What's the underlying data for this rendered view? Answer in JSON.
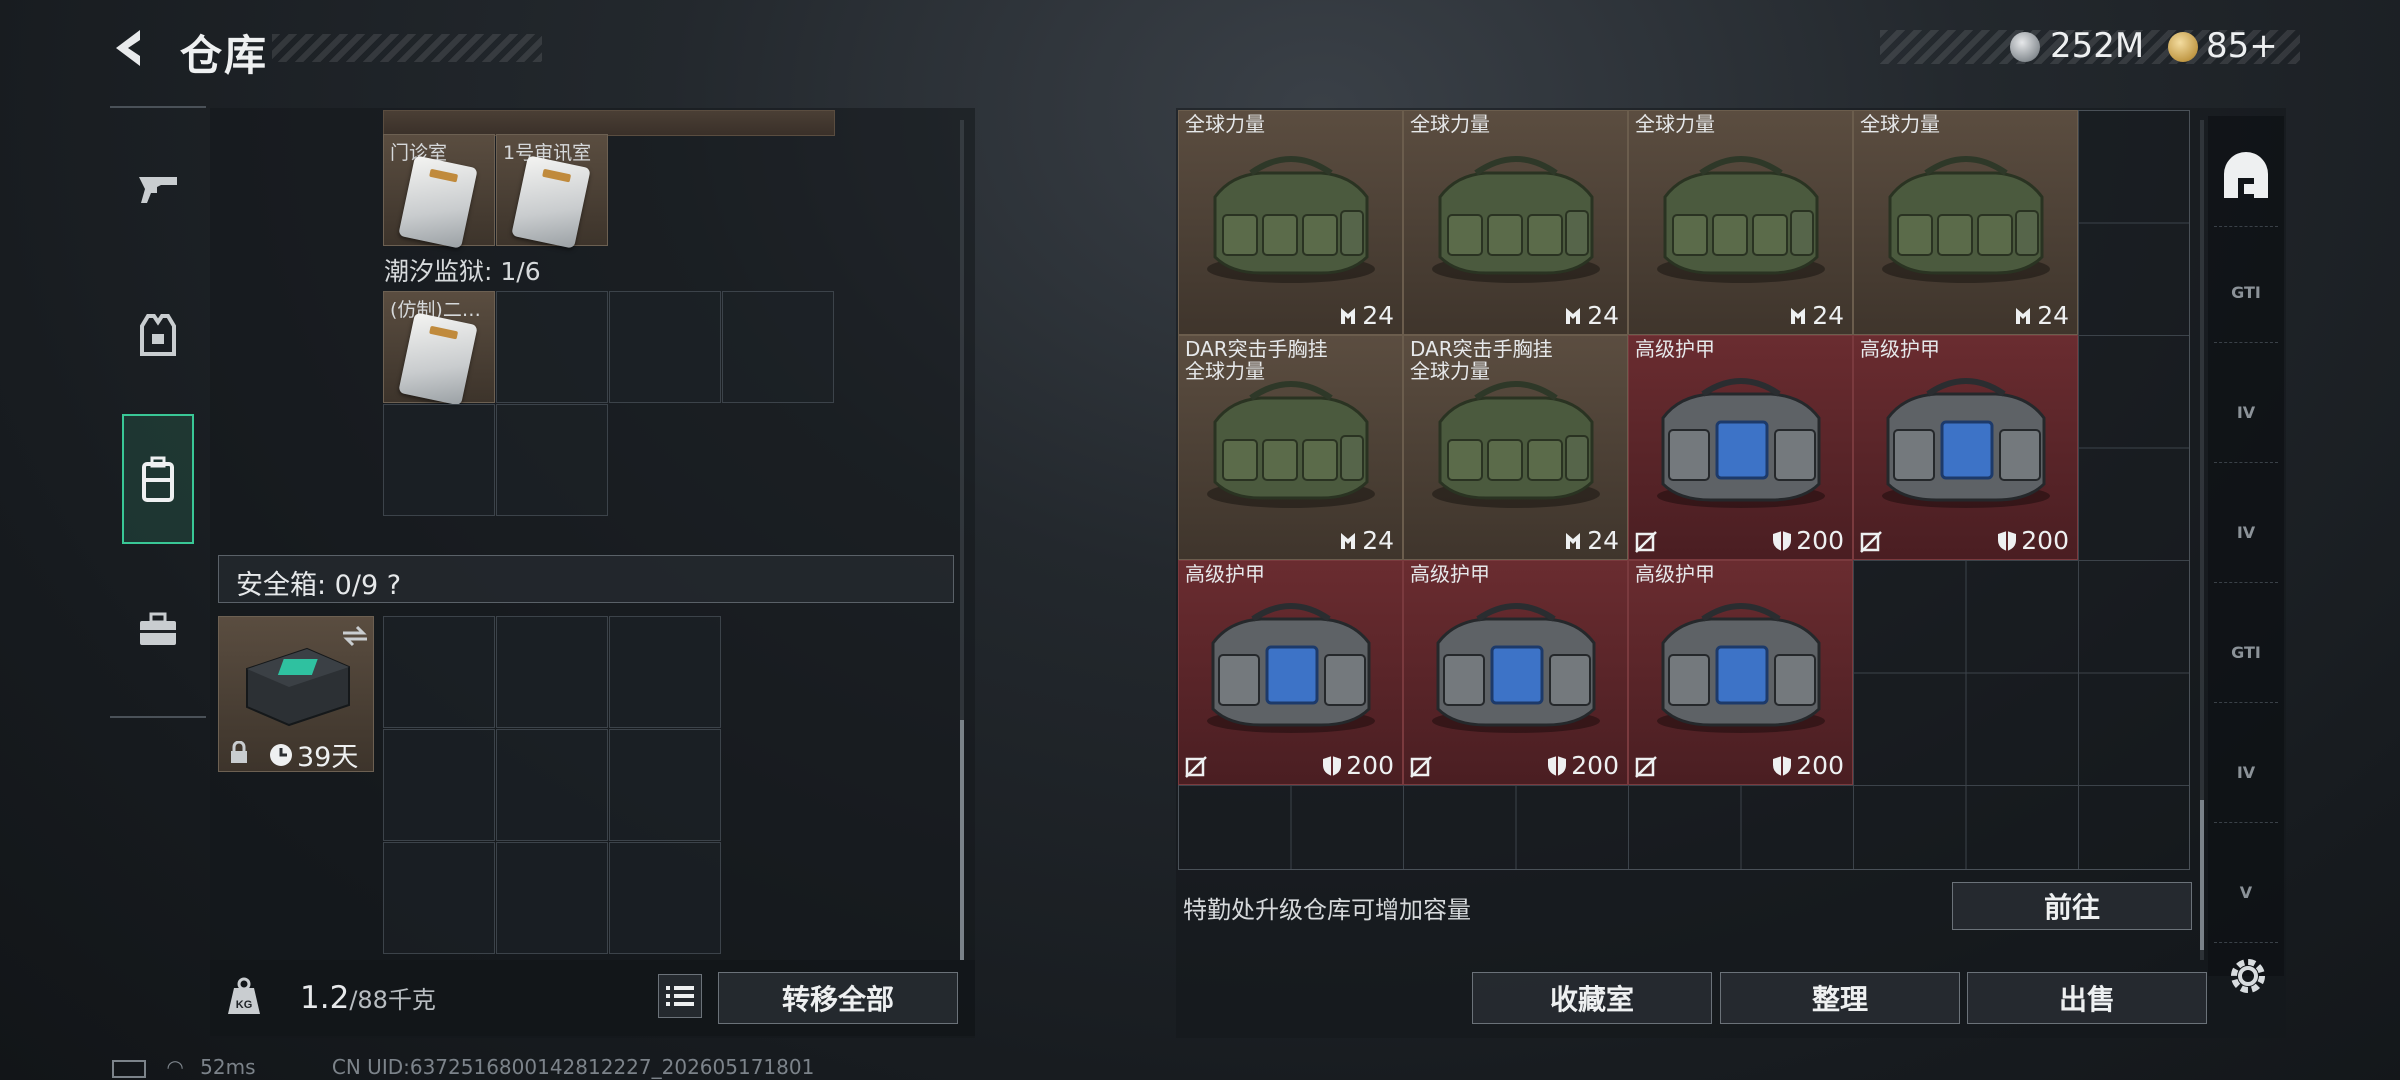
{
  "header": {
    "title": "仓库",
    "currency_1": "252M",
    "currency_2": "85+"
  },
  "left": {
    "row_top_cells": [
      {
        "label": "门诊室"
      },
      {
        "label": "1号审讯室"
      }
    ],
    "section_label": "潮汐监狱: 1/6",
    "prison_item_label": "(仿制)二…",
    "safebox_label": "安全箱: 0/9 ?",
    "safebox_time": "39天",
    "weight_value": "1.2",
    "weight_unit": "/88千克",
    "transfer_all": "转移全部"
  },
  "right": {
    "items": [
      {
        "name": "全球力量",
        "value": "24",
        "type": "green",
        "stat": "capacity"
      },
      {
        "name": "全球力量",
        "value": "24",
        "type": "green",
        "stat": "capacity"
      },
      {
        "name": "全球力量",
        "value": "24",
        "type": "green",
        "stat": "capacity"
      },
      {
        "name": "全球力量",
        "value": "24",
        "type": "green",
        "stat": "capacity"
      },
      {
        "name": "DAR突击手胸挂\n全球力量",
        "value": "24",
        "type": "green",
        "stat": "capacity"
      },
      {
        "name": "DAR突击手胸挂\n全球力量",
        "value": "24",
        "type": "green",
        "stat": "capacity"
      },
      {
        "name": "高级护甲",
        "value": "200",
        "type": "red",
        "stat": "durability"
      },
      {
        "name": "高级护甲",
        "value": "200",
        "type": "red",
        "stat": "durability"
      },
      {
        "name": "高级护甲",
        "value": "200",
        "type": "red",
        "stat": "durability"
      },
      {
        "name": "高级护甲",
        "value": "200",
        "type": "red",
        "stat": "durability"
      },
      {
        "name": "高级护甲",
        "value": "200",
        "type": "red",
        "stat": "durability"
      }
    ],
    "hint": "特勤处升级仓库可增加容量",
    "goto": "前往",
    "collection": "收藏室",
    "sort": "整理",
    "sell": "出售"
  },
  "right_rail": {
    "labels": [
      "GTI",
      "IV",
      "IV",
      "GTI",
      "IV",
      "V"
    ]
  },
  "status_bar": {
    "ping": "52ms",
    "uid": "CN UID:6372516800142812227_202605171801"
  },
  "colors": {
    "accent": "#39c796",
    "green_item_bg": "#4a3f35",
    "red_item_bg": "#5a2428"
  }
}
